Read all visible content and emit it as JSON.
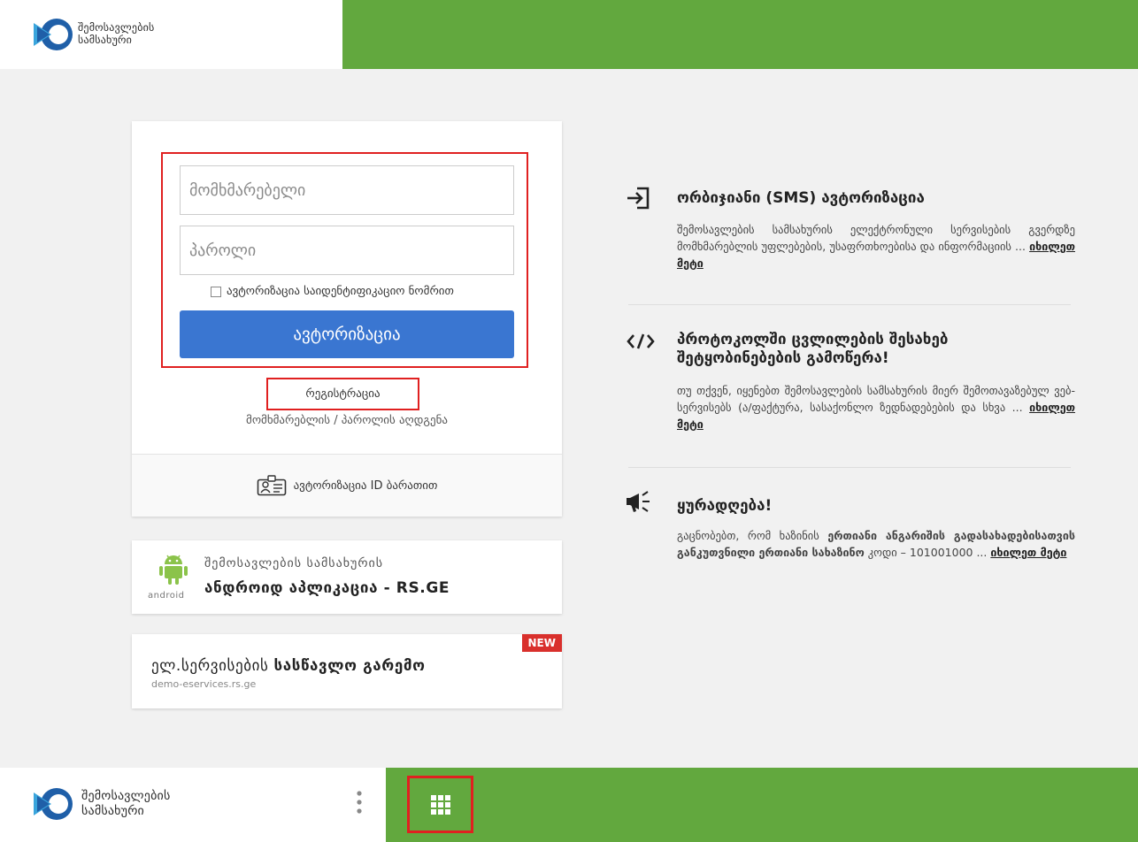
{
  "header": {
    "logo_line1": "შემოსავლების",
    "logo_line2": "სამსახური"
  },
  "login": {
    "username_placeholder": "მომხმარებელი",
    "password_placeholder": "პაროლი",
    "id_checkbox_label": "ავტორიზაცია საიდენტიფიკაციო ნომრით",
    "submit_label": "ავტორიზაცია",
    "register_label": "რეგისტრაცია",
    "recover_label": "მომხმარებლის / პაროლის აღდგენა",
    "id_card_label": "ავტორიზაცია ID ბარათით"
  },
  "android_promo": {
    "line1": "შემოსავლების სამსახურის",
    "line2": "ანდროიდ აპლიკაცია - RS.GE",
    "android_word": "android"
  },
  "demo_promo": {
    "title_part1": "ელ.სერვისების ",
    "title_part2": "სასწავლო გარემო",
    "subtitle": "demo-eservices.rs.ge",
    "badge": "NEW"
  },
  "info": [
    {
      "icon": "login-icon",
      "title": "ორბიჯიანი (SMS) ავტორიზაცია",
      "body": "შემოსავლების სამსახურის ელექტრონული სერვისების გვერდზე მომხმარებლის უფლებების, უსაფრთხოებისა და ინფორმაციის ... ",
      "more": "იხილეთ მეტი"
    },
    {
      "icon": "code-icon",
      "title": "პროტოკოლში ცვლილების შესახებ შეტყობინებების გამოწერა!",
      "body": "თუ თქვენ, იყენებთ შემოსავლების სამსახურის მიერ შემოთავაზებულ ვებ-სერვისებს (ა/ფაქტურა, სასაქონლო ზედნადებების და სხვა ... ",
      "more": "იხილეთ მეტი"
    },
    {
      "icon": "megaphone-icon",
      "title": "ყურადღება!",
      "body_plain1": "გაცნობებთ, რომ ხაზინის ",
      "body_bold": "ერთიანი ანგარიშის გადასახადებისათვის განკუთვნილი ერთიანი სახაზინო",
      "body_plain2": " კოდი – 101001000 ... ",
      "more": "იხილეთ მეტი"
    }
  ],
  "footer": {
    "logo_line1": "შემოსავლების",
    "logo_line2": "სამსახური"
  },
  "colors": {
    "brand_green": "#62a83e",
    "primary_blue": "#3a76d1",
    "highlight_red": "#e02020"
  }
}
